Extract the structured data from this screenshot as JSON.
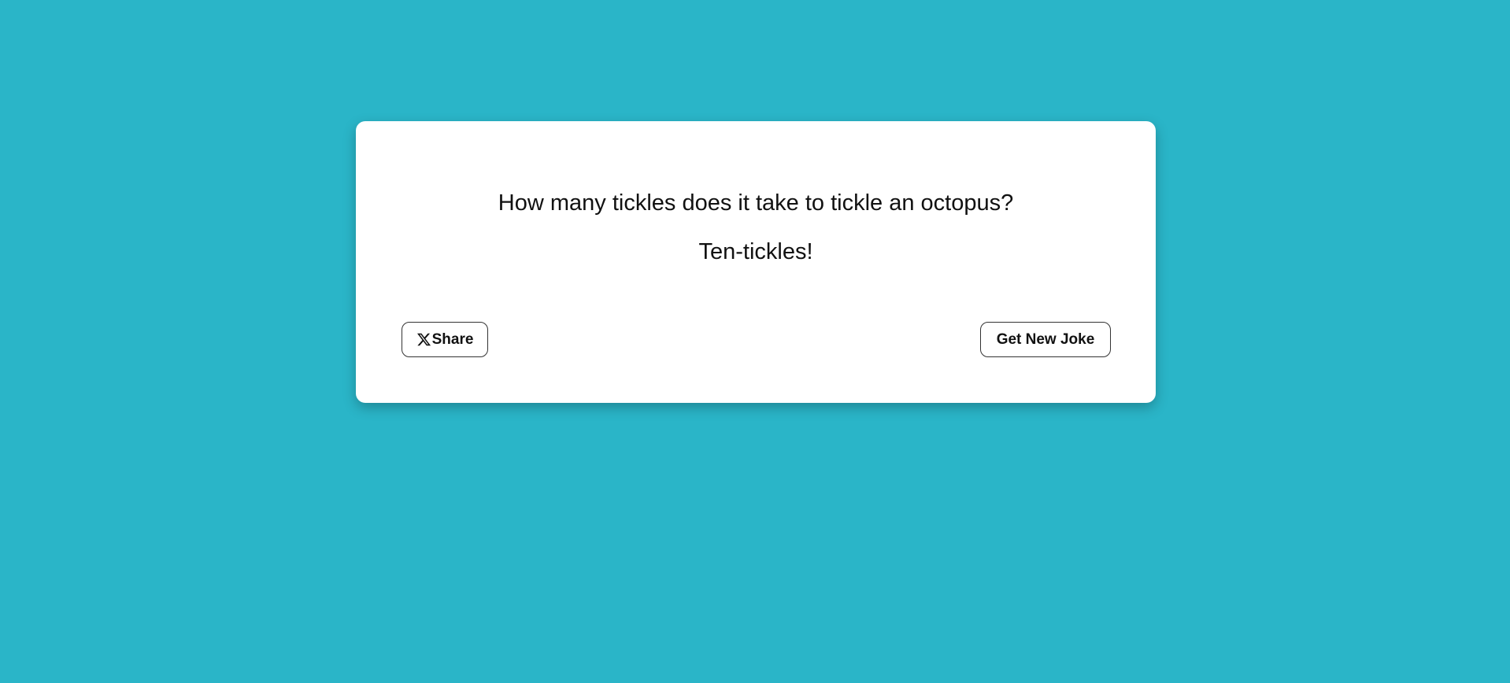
{
  "colors": {
    "background": "#2ab5c8",
    "card": "#ffffff",
    "text": "#111111"
  },
  "joke": {
    "setup": "How many tickles does it take to tickle an octopus?",
    "punchline": "Ten-tickles!"
  },
  "actions": {
    "share_icon": "x-logo-icon",
    "share_label": "Share",
    "new_joke_label": "Get New Joke"
  }
}
